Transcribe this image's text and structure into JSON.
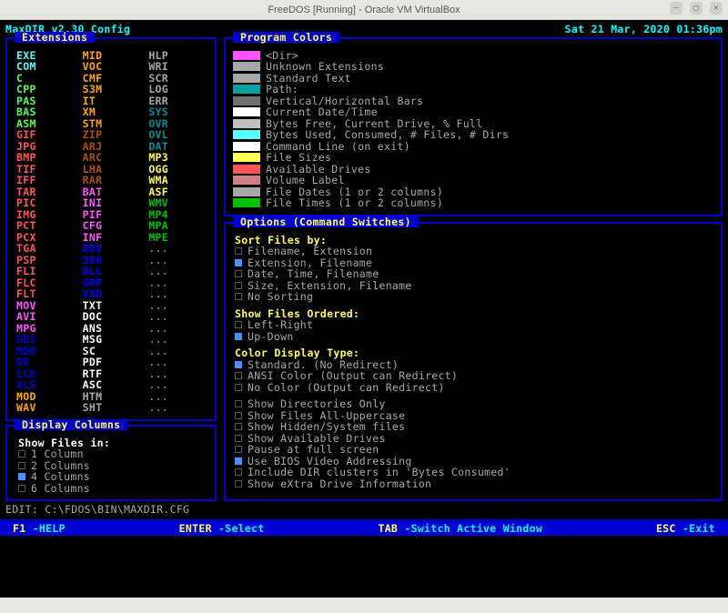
{
  "vm": {
    "title": "FreeDOS [Running] - Oracle VM VirtualBox"
  },
  "header": {
    "title": "MaxDIR v2.30 Config",
    "datetime": "Sat 21 Mar, 2020 01:36pm"
  },
  "panels": {
    "extensions": {
      "title": "Extensions"
    },
    "program_colors": {
      "title": "Program Colors"
    },
    "options": {
      "title": "Options (Command Switches)"
    },
    "display_columns": {
      "title": "Display Columns"
    }
  },
  "extensions": [
    {
      "t": "EXE",
      "c": "#55ffff"
    },
    {
      "t": "MID",
      "c": "#ffa800"
    },
    {
      "t": "HLP",
      "c": "#a8a8a8"
    },
    {
      "t": "COM",
      "c": "#55ffff"
    },
    {
      "t": "VOC",
      "c": "#ffa800"
    },
    {
      "t": "WRI",
      "c": "#a8a8a8"
    },
    {
      "t": "C",
      "c": "#55ff55"
    },
    {
      "t": "CMF",
      "c": "#ffa800"
    },
    {
      "t": "SCR",
      "c": "#a8a8a8"
    },
    {
      "t": "CPP",
      "c": "#55ff55"
    },
    {
      "t": "S3M",
      "c": "#ffa800"
    },
    {
      "t": "LOG",
      "c": "#a8a8a8"
    },
    {
      "t": "PAS",
      "c": "#55ff55"
    },
    {
      "t": "IT",
      "c": "#ffa800"
    },
    {
      "t": "ERR",
      "c": "#a8a8a8"
    },
    {
      "t": "BAS",
      "c": "#55ff55"
    },
    {
      "t": "XM",
      "c": "#ffa800"
    },
    {
      "t": "SYS",
      "c": "#009090"
    },
    {
      "t": "ASM",
      "c": "#55ff55"
    },
    {
      "t": "STM",
      "c": "#ffa800"
    },
    {
      "t": "OVR",
      "c": "#009090"
    },
    {
      "t": "GIF",
      "c": "#ff5555"
    },
    {
      "t": "ZIP",
      "c": "#b05000"
    },
    {
      "t": "OVL",
      "c": "#009090"
    },
    {
      "t": "JPG",
      "c": "#ff5555"
    },
    {
      "t": "ARJ",
      "c": "#b05000"
    },
    {
      "t": "DAT",
      "c": "#009090"
    },
    {
      "t": "BMP",
      "c": "#ff5555"
    },
    {
      "t": "ARC",
      "c": "#b05000"
    },
    {
      "t": "MP3",
      "c": "#ffff55"
    },
    {
      "t": "TIF",
      "c": "#ff5555"
    },
    {
      "t": "LHA",
      "c": "#b05000"
    },
    {
      "t": "OGG",
      "c": "#ffff55"
    },
    {
      "t": "IFF",
      "c": "#ff5555"
    },
    {
      "t": "RAR",
      "c": "#b05000"
    },
    {
      "t": "WMA",
      "c": "#ffff55"
    },
    {
      "t": "TAR",
      "c": "#ff5555"
    },
    {
      "t": "BAT",
      "c": "#ff55ff"
    },
    {
      "t": "ASF",
      "c": "#ffff55"
    },
    {
      "t": "PIC",
      "c": "#ff5555"
    },
    {
      "t": "INI",
      "c": "#ff55ff"
    },
    {
      "t": "WMV",
      "c": "#00c000"
    },
    {
      "t": "IMG",
      "c": "#ff5555"
    },
    {
      "t": "PIF",
      "c": "#ff55ff"
    },
    {
      "t": "MP4",
      "c": "#00c000"
    },
    {
      "t": "PCT",
      "c": "#ff5555"
    },
    {
      "t": "CFG",
      "c": "#ff55ff"
    },
    {
      "t": "MPA",
      "c": "#00c000"
    },
    {
      "t": "PCX",
      "c": "#ff5555"
    },
    {
      "t": "INF",
      "c": "#ff55ff"
    },
    {
      "t": "MPE",
      "c": "#00c000"
    },
    {
      "t": "TGA",
      "c": "#ff5555"
    },
    {
      "t": "DRV",
      "c": "#0000ff"
    },
    {
      "t": "...",
      "c": "#707070"
    },
    {
      "t": "PSP",
      "c": "#ff5555"
    },
    {
      "t": "386",
      "c": "#0000ff"
    },
    {
      "t": "...",
      "c": "#707070"
    },
    {
      "t": "FLI",
      "c": "#ff5555"
    },
    {
      "t": "DLL",
      "c": "#0000ff"
    },
    {
      "t": "...",
      "c": "#707070"
    },
    {
      "t": "FLC",
      "c": "#ff5555"
    },
    {
      "t": "GRP",
      "c": "#0000ff"
    },
    {
      "t": "...",
      "c": "#707070"
    },
    {
      "t": "FLT",
      "c": "#ff5555"
    },
    {
      "t": "VXD",
      "c": "#0000ff"
    },
    {
      "t": "...",
      "c": "#707070"
    },
    {
      "t": "MOV",
      "c": "#ff55ff"
    },
    {
      "t": "TXT",
      "c": "#ffffff"
    },
    {
      "t": "...",
      "c": "#707070"
    },
    {
      "t": "AVI",
      "c": "#ff55ff"
    },
    {
      "t": "DOC",
      "c": "#ffffff"
    },
    {
      "t": "...",
      "c": "#707070"
    },
    {
      "t": "MPG",
      "c": "#ff55ff"
    },
    {
      "t": "ANS",
      "c": "#ffffff"
    },
    {
      "t": "...",
      "c": "#707070"
    },
    {
      "t": "DBI",
      "c": "#0000d0"
    },
    {
      "t": "MSG",
      "c": "#ffffff"
    },
    {
      "t": "...",
      "c": "#707070"
    },
    {
      "t": "MDB",
      "c": "#0000d0"
    },
    {
      "t": "SC",
      "c": "#ffffff"
    },
    {
      "t": "...",
      "c": "#707070"
    },
    {
      "t": "DB",
      "c": "#0000d0"
    },
    {
      "t": "PDF",
      "c": "#ffffff"
    },
    {
      "t": "...",
      "c": "#707070"
    },
    {
      "t": "LCK",
      "c": "#0000d0"
    },
    {
      "t": "RTF",
      "c": "#ffffff"
    },
    {
      "t": "...",
      "c": "#707070"
    },
    {
      "t": "XLS",
      "c": "#0000d0"
    },
    {
      "t": "ASC",
      "c": "#ffffff"
    },
    {
      "t": "...",
      "c": "#707070"
    },
    {
      "t": "MOD",
      "c": "#ffa800"
    },
    {
      "t": "HTM",
      "c": "#a8a8a8"
    },
    {
      "t": "...",
      "c": "#707070"
    },
    {
      "t": "WAV",
      "c": "#ffa800"
    },
    {
      "t": "SHT",
      "c": "#a8a8a8"
    },
    {
      "t": "...",
      "c": "#707070"
    }
  ],
  "program_colors": [
    {
      "c": "#ff55ff",
      "l": "<Dir>"
    },
    {
      "c": "#a8a8a8",
      "l": "Unknown Extensions"
    },
    {
      "c": "#a8a8a8",
      "l": "Standard Text"
    },
    {
      "c": "#00a0a0",
      "l": "Path:"
    },
    {
      "c": "#707070",
      "l": "Vertical/Horizontal Bars"
    },
    {
      "c": "#ffffff",
      "l": "Current Date/Time"
    },
    {
      "c": "#c0c0c0",
      "l": "Bytes Free, Current Drive, % Full"
    },
    {
      "c": "#55ffff",
      "l": "Bytes Used, Consumed, # Files, # Dirs"
    },
    {
      "c": "#ffffff",
      "l": "Command Line (on exit)"
    },
    {
      "c": "#ffff55",
      "l": "File Sizes"
    },
    {
      "c": "#ff5555",
      "l": "Available Drives"
    },
    {
      "c": "#d08080",
      "l": "Volume Label"
    },
    {
      "c": "#a8a8a8",
      "l": "File Dates (1 or 2 columns)"
    },
    {
      "c": "#00c000",
      "l": "File Times (1 or 2 columns)"
    }
  ],
  "options": {
    "sort_head": "Sort Files by:",
    "sort": [
      {
        "on": false,
        "l": "Filename, Extension"
      },
      {
        "on": true,
        "l": "Extension, Filename"
      },
      {
        "on": false,
        "l": "Date, Time, Filename"
      },
      {
        "on": false,
        "l": "Size, Extension, Filename"
      },
      {
        "on": false,
        "l": "No Sorting"
      }
    ],
    "order_head": "Show Files Ordered:",
    "order": [
      {
        "on": false,
        "l": "Left-Right"
      },
      {
        "on": true,
        "l": "Up-Down"
      }
    ],
    "color_head": "Color Display Type:",
    "color": [
      {
        "on": true,
        "l": "Standard.  (No Redirect)"
      },
      {
        "on": false,
        "l": "ANSI Color (Output can Redirect)"
      },
      {
        "on": false,
        "l": "No Color   (Output can Redirect)"
      }
    ],
    "flags": [
      {
        "on": false,
        "l": "Show Directories Only"
      },
      {
        "on": false,
        "l": "Show Files All-Uppercase"
      },
      {
        "on": false,
        "l": "Show Hidden/System files"
      },
      {
        "on": false,
        "l": "Show Available Drives"
      },
      {
        "on": false,
        "l": "Pause at full screen"
      },
      {
        "on": true,
        "l": "Use BIOS Video Addressing"
      },
      {
        "on": false,
        "l": "Include DIR clusters in 'Bytes Consumed'"
      },
      {
        "on": false,
        "l": "Show eXtra Drive Information"
      }
    ]
  },
  "display_columns": {
    "head": "Show Files in:",
    "items": [
      {
        "on": false,
        "l": "1 Column"
      },
      {
        "on": false,
        "l": "2 Columns"
      },
      {
        "on": true,
        "l": "4 Columns"
      },
      {
        "on": false,
        "l": "6 Columns"
      }
    ]
  },
  "edit_line": "EDIT: C:\\FDOS\\BIN\\MAXDIR.CFG",
  "status": {
    "f1": "F1",
    "f1l": "-HELP",
    "enter": "ENTER",
    "enterl": "-Select",
    "tab": "TAB",
    "tabl": "-Switch Active Window",
    "esc": "ESC",
    "escl": "-Exit"
  }
}
